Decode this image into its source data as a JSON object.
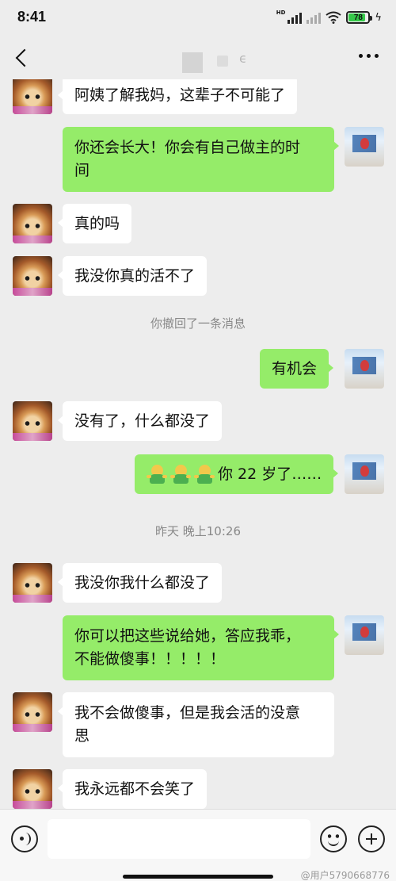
{
  "status_bar": {
    "time": "8:41",
    "hd_label": "HD",
    "battery_level": "78",
    "charging_icon": "lightning-icon"
  },
  "nav": {
    "back_icon": "chevron-left-icon",
    "title_glyph": "ϵ",
    "more_icon": "more-dots-icon"
  },
  "messages": [
    {
      "side": "recv",
      "text": "阿姨了解我妈，这辈子不可能了"
    },
    {
      "side": "sent",
      "text": "你还会长大！你会有自己做主的时\n间"
    },
    {
      "side": "recv",
      "text": "真的吗"
    },
    {
      "side": "recv",
      "text": "我没你真的活不了"
    },
    {
      "side": "system",
      "text": "你撤回了一条消息"
    },
    {
      "side": "sent",
      "text": "有机会"
    },
    {
      "side": "recv",
      "text": "没有了，什么都没了"
    },
    {
      "side": "sent",
      "text": "你 22 岁了……",
      "emoji": "hugging-person-emoji",
      "emoji_count": 3
    },
    {
      "side": "timestamp",
      "text": "昨天 晚上10:26"
    },
    {
      "side": "recv",
      "text": "我没你我什么都没了"
    },
    {
      "side": "sent",
      "text": "你可以把这些说给她，答应我乖，\n不能做傻事！！！！！"
    },
    {
      "side": "recv",
      "text": "我不会做傻事，但是我会活的没意\n思"
    },
    {
      "side": "recv",
      "text": "我永远都不会笑了"
    }
  ],
  "input_bar": {
    "voice_icon": "voice-icon",
    "emoji_icon": "smiley-icon",
    "plus_icon": "plus-circle-icon",
    "watermark": "@用户5790668776"
  },
  "colors": {
    "sent_bubble": "#95ec69",
    "recv_bubble": "#ffffff",
    "background": "#ededed"
  }
}
